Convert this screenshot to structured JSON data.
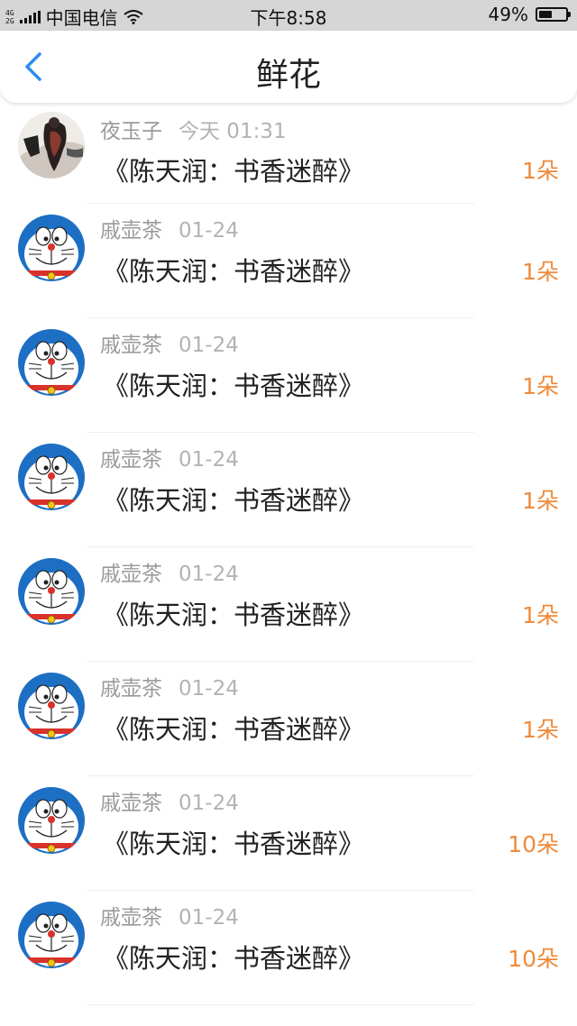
{
  "status_bar": {
    "network_top": "4G",
    "network_bottom": "2G",
    "carrier": "中国电信",
    "time": "下午8:58",
    "battery_percent": "49%",
    "battery_level": 0.49
  },
  "header": {
    "title": "鲜花"
  },
  "colors": {
    "accent": "#ef8a3a",
    "back_arrow": "#2c8cf0",
    "status_bar_bg": "#d6d6d6"
  },
  "items": [
    {
      "user": "夜玉子",
      "time": "今天 01:31",
      "book": "《陈天润：书香迷醉》",
      "count": "1朵",
      "avatar": "ink-painting-avatar"
    },
    {
      "user": "戚壶茶",
      "time": "01-24",
      "book": "《陈天润：书香迷醉》",
      "count": "1朵",
      "avatar": "doraemon-avatar"
    },
    {
      "user": "戚壶茶",
      "time": "01-24",
      "book": "《陈天润：书香迷醉》",
      "count": "1朵",
      "avatar": "doraemon-avatar"
    },
    {
      "user": "戚壶茶",
      "time": "01-24",
      "book": "《陈天润：书香迷醉》",
      "count": "1朵",
      "avatar": "doraemon-avatar"
    },
    {
      "user": "戚壶茶",
      "time": "01-24",
      "book": "《陈天润：书香迷醉》",
      "count": "1朵",
      "avatar": "doraemon-avatar"
    },
    {
      "user": "戚壶茶",
      "time": "01-24",
      "book": "《陈天润：书香迷醉》",
      "count": "1朵",
      "avatar": "doraemon-avatar"
    },
    {
      "user": "戚壶茶",
      "time": "01-24",
      "book": "《陈天润：书香迷醉》",
      "count": "10朵",
      "avatar": "doraemon-avatar"
    },
    {
      "user": "戚壶茶",
      "time": "01-24",
      "book": "《陈天润：书香迷醉》",
      "count": "10朵",
      "avatar": "doraemon-avatar"
    }
  ]
}
